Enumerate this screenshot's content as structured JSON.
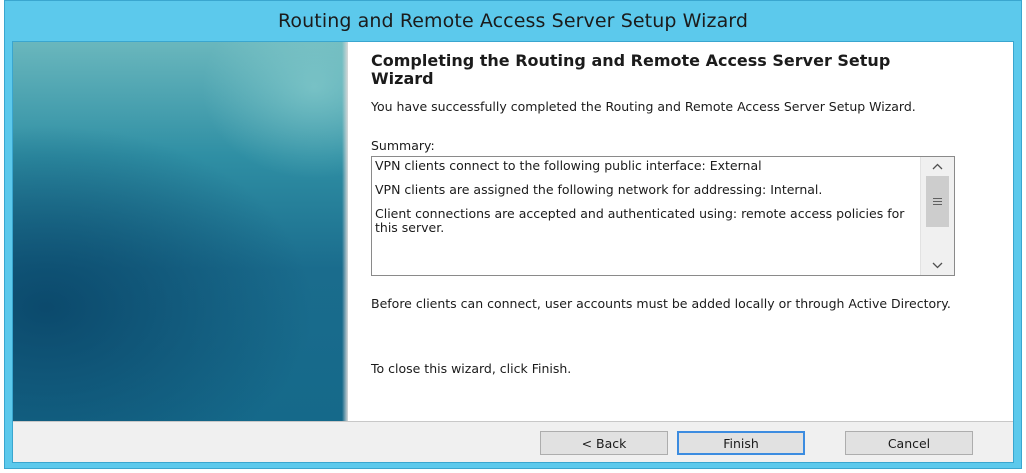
{
  "window": {
    "title": "Routing and Remote Access Server Setup Wizard"
  },
  "page": {
    "heading": "Completing the Routing and Remote Access Server Setup Wizard",
    "intro": "You have successfully completed the Routing and Remote Access Server Setup Wizard.",
    "summary_label": "Summary:",
    "summary_lines": [
      "VPN clients connect to the following public interface: External",
      "VPN clients are assigned the following network for addressing: Internal.",
      "Client connections are accepted and authenticated using: remote access policies for this server."
    ],
    "before_note": "Before clients can connect, user accounts must be added locally or through Active Directory.",
    "close_hint": "To close this wizard, click Finish."
  },
  "buttons": {
    "back": "< Back",
    "finish": "Finish",
    "cancel": "Cancel"
  },
  "icons": {
    "scroll_up": "chevron-up-icon",
    "scroll_down": "chevron-down-icon",
    "scroll_grip": "grip-icon"
  },
  "colors": {
    "title_bar": "#5cc9ec",
    "default_button_border": "#3c8ce0",
    "side_panel": "#1a6c8d"
  }
}
